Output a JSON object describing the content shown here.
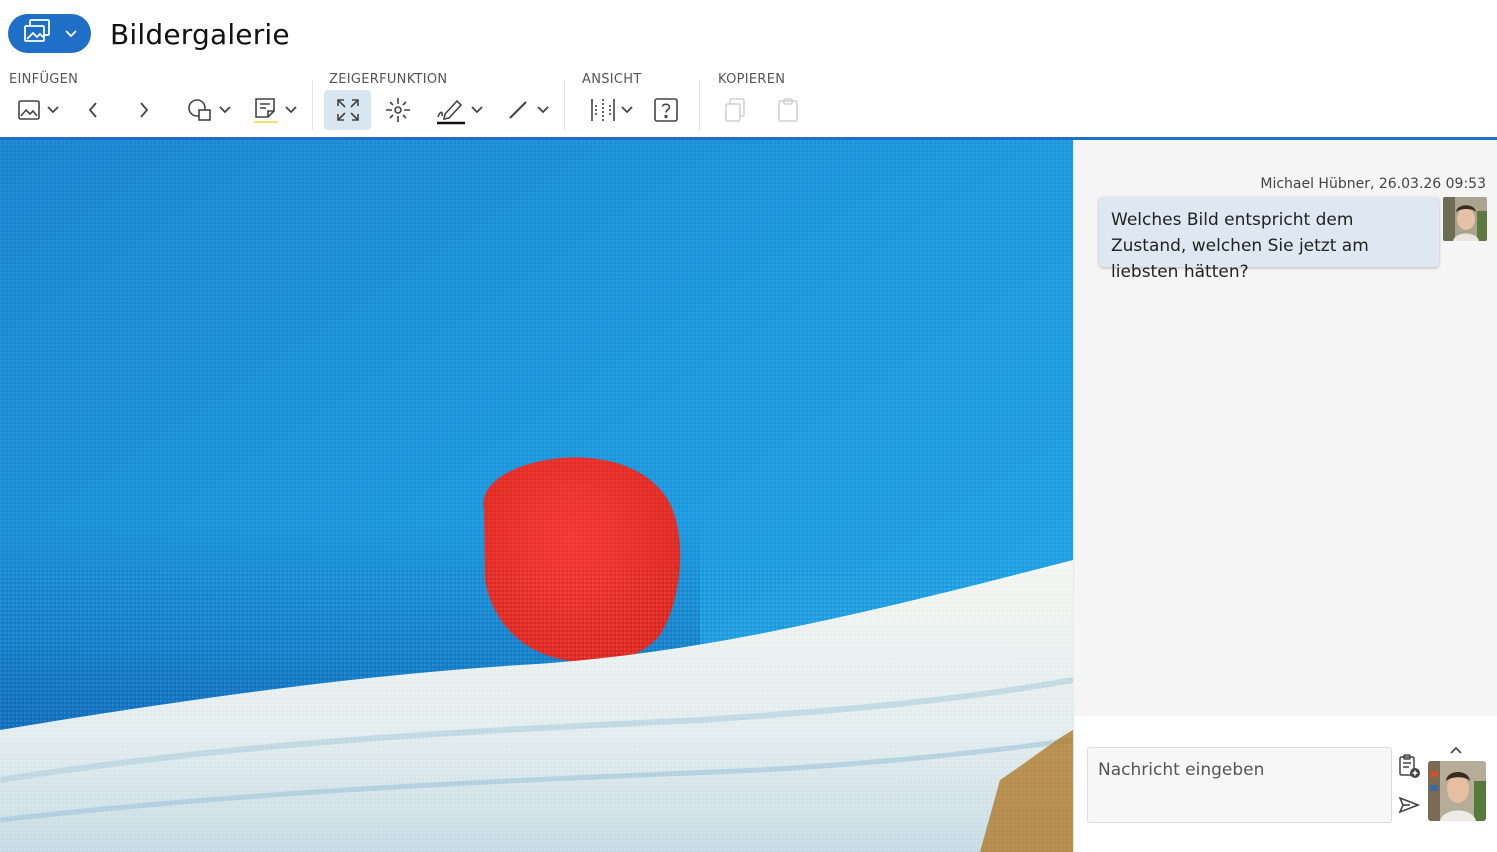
{
  "header": {
    "title": "Bildergalerie",
    "app_button_icon": "gallery-icon"
  },
  "toolbar": {
    "groups": [
      {
        "label": "EINFÜGEN"
      },
      {
        "label": "ZEIGERFUNKTION"
      },
      {
        "label": "ANSICHT"
      },
      {
        "label": "KOPIEREN"
      }
    ],
    "accent": "#1f6fc5",
    "active_bg": "#d8e6f2"
  },
  "chat": {
    "message": {
      "author_time": "Michael Hübner, 26.03.26 09:53",
      "text": "Welches Bild entspricht dem Zustand, welchen Sie jetzt am liebsten hätten?"
    },
    "input": {
      "placeholder": "Nachricht eingeben",
      "value": ""
    }
  }
}
